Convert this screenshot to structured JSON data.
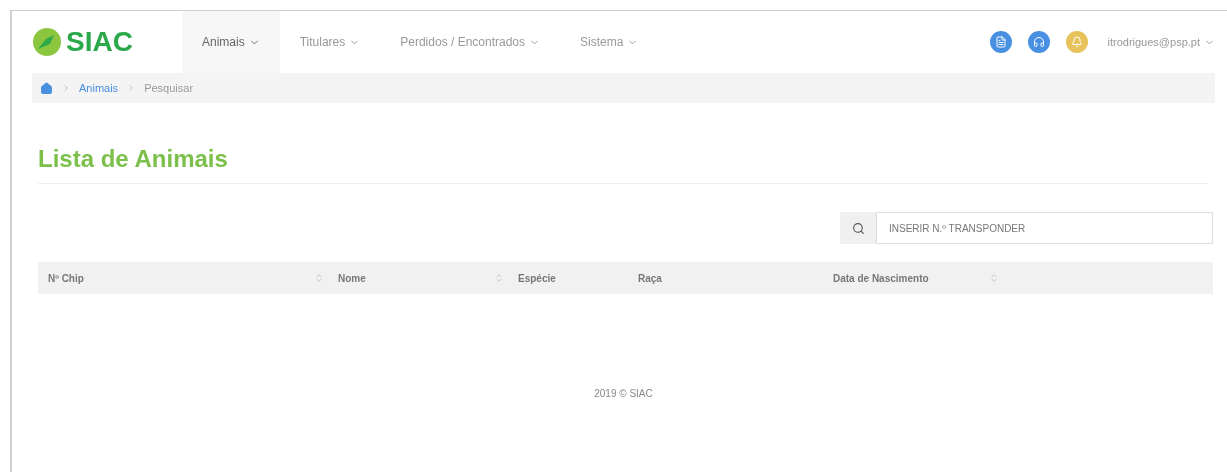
{
  "brand": {
    "name": "SIAC"
  },
  "nav": [
    {
      "label": "Animais",
      "selected": true
    },
    {
      "label": "Titulares",
      "selected": false
    },
    {
      "label": "Perdidos / Encontrados",
      "selected": false
    },
    {
      "label": "Sistema",
      "selected": false
    }
  ],
  "header_icons": [
    {
      "kind": "document",
      "color": "#4a90e2"
    },
    {
      "kind": "headset",
      "color": "#4a90e2"
    },
    {
      "kind": "bell",
      "color": "#e8c25a"
    }
  ],
  "user": {
    "email": "itrodrigues@psp.pt"
  },
  "breadcrumb": {
    "items": [
      "Animais",
      "Pesquisar"
    ]
  },
  "title": "Lista de Animais",
  "search": {
    "placeholder": "INSERIR N.º TRANSPONDER"
  },
  "table": {
    "columns": [
      {
        "label": "Nº Chip",
        "sortable": true
      },
      {
        "label": "Nome",
        "sortable": true
      },
      {
        "label": "Espécie",
        "sortable": false
      },
      {
        "label": "Raça",
        "sortable": false
      },
      {
        "label": "Data de Nascimento",
        "sortable": true
      }
    ]
  },
  "footer": "2019 © SIAC"
}
